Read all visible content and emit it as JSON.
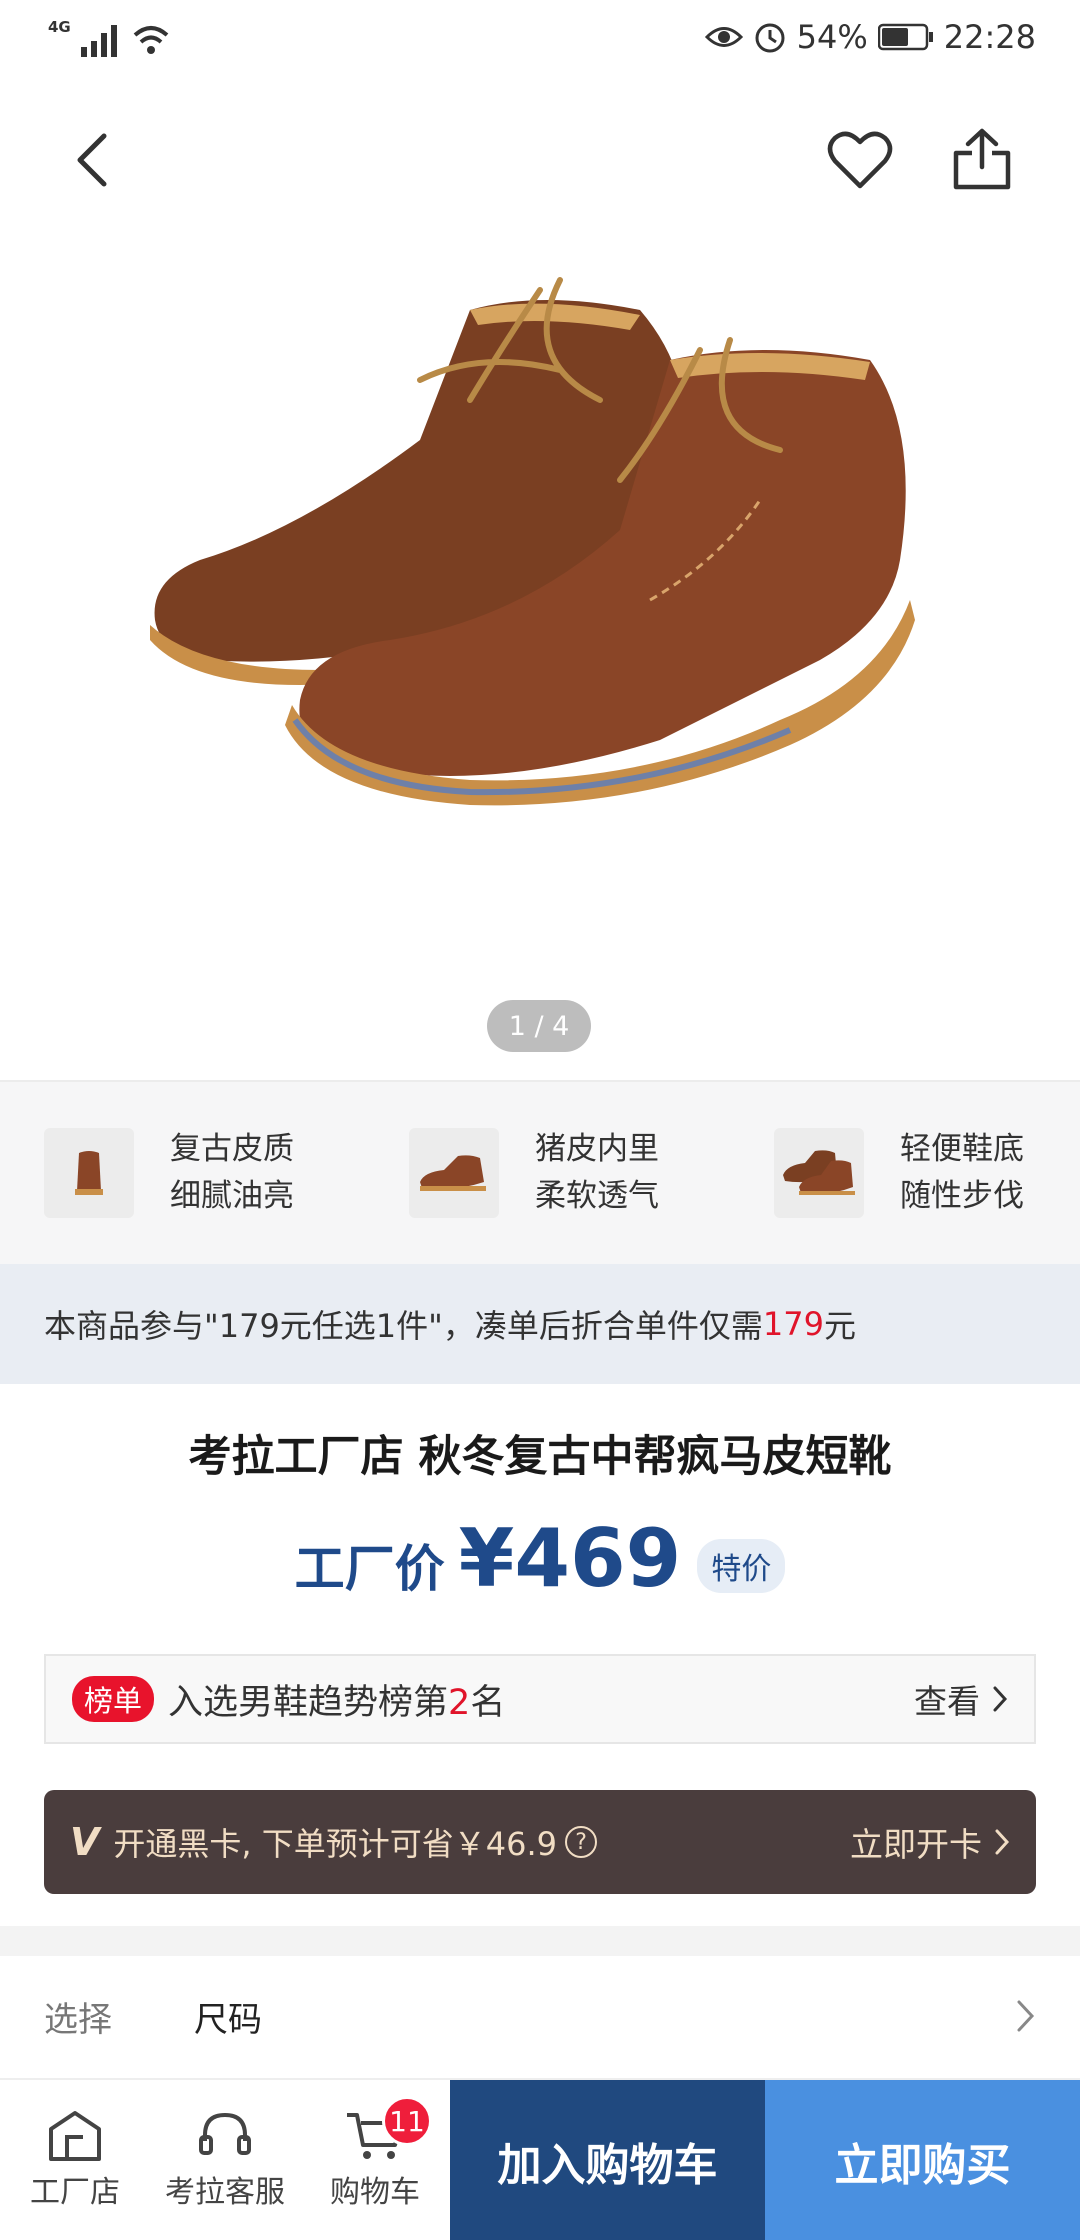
{
  "status": {
    "network": "4G",
    "battery": "54%",
    "time": "22:28"
  },
  "header": {
    "back_icon": "back-icon",
    "favorite_icon": "heart-icon",
    "share_icon": "share-icon"
  },
  "carousel": {
    "indicator": "1 / 4"
  },
  "features": [
    {
      "line1": "复古皮质",
      "line2": "细腻油亮"
    },
    {
      "line1": "猪皮内里",
      "line2": "柔软透气"
    },
    {
      "line1": "轻便鞋底",
      "line2": "随性步伐"
    }
  ],
  "promo": {
    "prefix": "本商品参与\"179元任选1件\"，凑单后折合单件仅需",
    "amount": "179",
    "suffix": "元"
  },
  "product": {
    "title": "考拉工厂店 秋冬复古中帮疯马皮短靴",
    "price_label": "工厂价",
    "price": "¥469",
    "price_tag": "特价"
  },
  "ranking": {
    "badge": "榜单",
    "text_prefix": "入选男鞋趋势榜第",
    "rank": "2",
    "text_suffix": "名",
    "link": "查看"
  },
  "black_card": {
    "logo": "V",
    "text": "开通黑卡, 下单预计可省￥46.9",
    "help": "?",
    "link": "立即开卡"
  },
  "spec": {
    "label": "选择",
    "value": "尺码"
  },
  "bottom_nav": {
    "store": "工厂店",
    "service": "考拉客服",
    "cart": "购物车",
    "cart_badge": "11",
    "add_to_cart": "加入购物车",
    "buy_now": "立即购买"
  },
  "colors": {
    "brand_blue": "#20497f",
    "buy_blue": "#4a90e0",
    "red": "#e0142a",
    "black_card_bg": "#4a3d3d"
  }
}
